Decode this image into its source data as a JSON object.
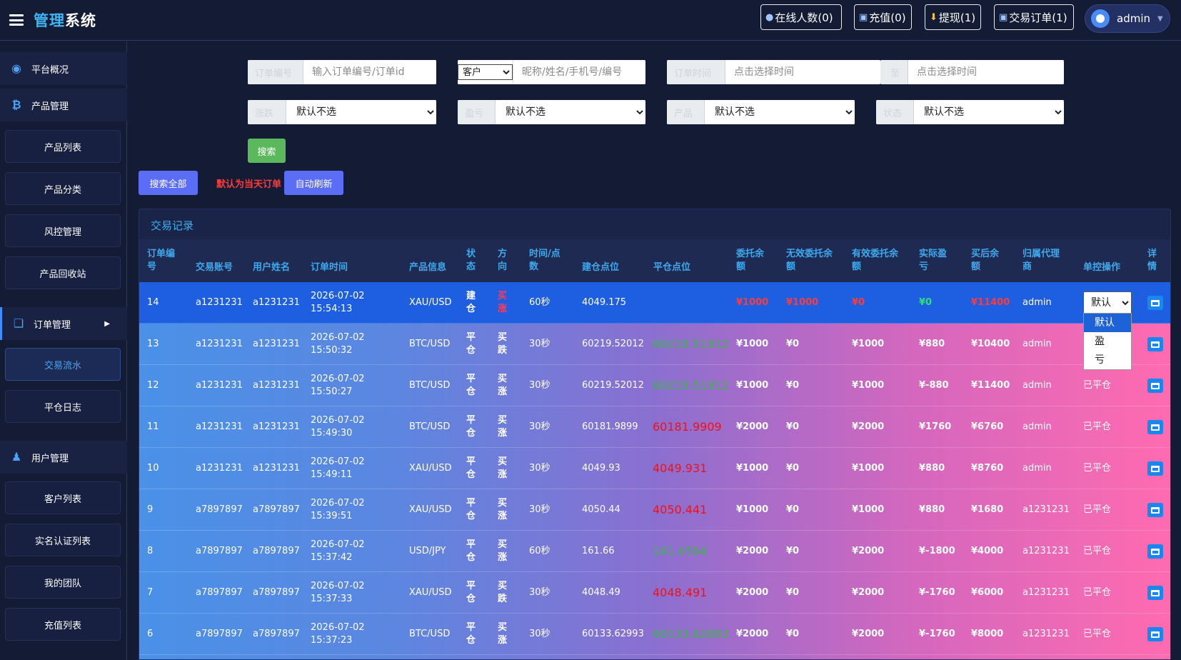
{
  "header": {
    "logo_part1": "管理",
    "logo_part2": "系统",
    "online": "在线人数(0)",
    "recharge": "充值(0)",
    "withdraw": "提现(1)",
    "orders": "交易订单(1)",
    "admin": "admin"
  },
  "sidebar": {
    "groups": [
      "平台概况",
      "产品管理",
      "订单管理",
      "用户管理"
    ],
    "items": [
      "产品列表",
      "产品分类",
      "风控管理",
      "产品回收站",
      "交易流水",
      "平仓日志",
      "客户列表",
      "实名认证列表",
      "我的团队",
      "充值列表"
    ]
  },
  "filters": {
    "order_no_label": "订单编号",
    "order_no_placeholder": "输入订单编号/订单id",
    "customer_option": "客户",
    "customer_placeholder": "昵称/姓名/手机号/编号",
    "time_label": "订单时间",
    "time_placeholder": "点击选择时间",
    "to_label": "至",
    "time_placeholder2": "点击选择时间",
    "updown_label": "涨跌",
    "profit_label": "盈亏",
    "product_label": "产品",
    "status_label": "状态",
    "default_option": "默认不选",
    "search_btn": "搜索",
    "search_all_btn": "搜索全部",
    "note": "默认为当天订单",
    "auto_refresh_btn": "自动刷新"
  },
  "panel": {
    "title": "交易记录",
    "headers": [
      "订单编号",
      "交易账号",
      "用户姓名",
      "订单时间",
      "产品信息",
      "状态",
      "方向",
      "时间/点数",
      "建仓点位",
      "平仓点位",
      "委托余额",
      "无效委托余额",
      "有效委托余额",
      "实际盈亏",
      "买后余额",
      "归属代理商",
      "单控操作",
      "详情"
    ]
  },
  "rows": [
    {
      "id": "14",
      "account": "a1231231",
      "name": "a1231231",
      "date": "2026-07-02",
      "time": "15:54:13",
      "product": "XAU/USD",
      "status": "建仓",
      "dir": "买涨",
      "period": "60秒",
      "open": "4049.175",
      "close": "",
      "close_color": "",
      "amount": "¥1000",
      "invalid": "¥1000",
      "valid": "¥0",
      "pnl": "¥0",
      "after": "¥11400",
      "agent": "admin",
      "op": ""
    },
    {
      "id": "13",
      "account": "a1231231",
      "name": "a1231231",
      "date": "2026-07-02",
      "time": "15:50:32",
      "product": "BTC/USD",
      "status": "平仓",
      "dir": "买跌",
      "period": "30秒",
      "open": "60219.52012",
      "close": "60219.51912",
      "close_color": "#3bb54a",
      "amount": "¥1000",
      "invalid": "¥0",
      "valid": "¥1000",
      "pnl": "¥880",
      "after": "¥10400",
      "agent": "admin",
      "op": ""
    },
    {
      "id": "12",
      "account": "a1231231",
      "name": "a1231231",
      "date": "2026-07-02",
      "time": "15:50:27",
      "product": "BTC/USD",
      "status": "平仓",
      "dir": "买涨",
      "period": "30秒",
      "open": "60219.52012",
      "close": "60219.51912",
      "close_color": "#3bb54a",
      "amount": "¥1000",
      "invalid": "¥0",
      "valid": "¥1000",
      "pnl": "¥-880",
      "after": "¥11400",
      "agent": "admin",
      "op": "已平仓"
    },
    {
      "id": "11",
      "account": "a1231231",
      "name": "a1231231",
      "date": "2026-07-02",
      "time": "15:49:30",
      "product": "BTC/USD",
      "status": "平仓",
      "dir": "买涨",
      "period": "30秒",
      "open": "60181.9899",
      "close": "60181.9909",
      "close_color": "#e8141c",
      "amount": "¥2000",
      "invalid": "¥0",
      "valid": "¥2000",
      "pnl": "¥1760",
      "after": "¥6760",
      "agent": "admin",
      "op": "已平仓"
    },
    {
      "id": "10",
      "account": "a1231231",
      "name": "a1231231",
      "date": "2026-07-02",
      "time": "15:49:11",
      "product": "XAU/USD",
      "status": "平仓",
      "dir": "买涨",
      "period": "30秒",
      "open": "4049.93",
      "close": "4049.931",
      "close_color": "#e8141c",
      "amount": "¥1000",
      "invalid": "¥0",
      "valid": "¥1000",
      "pnl": "¥880",
      "after": "¥8760",
      "agent": "admin",
      "op": "已平仓"
    },
    {
      "id": "9",
      "account": "a7897897",
      "name": "a7897897",
      "date": "2026-07-02",
      "time": "15:39:51",
      "product": "XAU/USD",
      "status": "平仓",
      "dir": "买涨",
      "period": "30秒",
      "open": "4050.44",
      "close": "4050.441",
      "close_color": "#e8141c",
      "amount": "¥1000",
      "invalid": "¥0",
      "valid": "¥1000",
      "pnl": "¥880",
      "after": "¥1680",
      "agent": "a1231231",
      "op": "已平仓"
    },
    {
      "id": "8",
      "account": "a7897897",
      "name": "a7897897",
      "date": "2026-07-02",
      "time": "15:37:42",
      "product": "USD/JPY",
      "status": "平仓",
      "dir": "买涨",
      "period": "60秒",
      "open": "161.66",
      "close": "161.6564",
      "close_color": "#3bb54a",
      "amount": "¥2000",
      "invalid": "¥0",
      "valid": "¥2000",
      "pnl": "¥-1800",
      "after": "¥4000",
      "agent": "a1231231",
      "op": "已平仓"
    },
    {
      "id": "7",
      "account": "a7897897",
      "name": "a7897897",
      "date": "2026-07-02",
      "time": "15:37:33",
      "product": "XAU/USD",
      "status": "平仓",
      "dir": "买跌",
      "period": "30秒",
      "open": "4048.49",
      "close": "4048.491",
      "close_color": "#e8141c",
      "amount": "¥2000",
      "invalid": "¥0",
      "valid": "¥2000",
      "pnl": "¥-1760",
      "after": "¥6000",
      "agent": "a1231231",
      "op": "已平仓"
    },
    {
      "id": "6",
      "account": "a7897897",
      "name": "a7897897",
      "date": "2026-07-02",
      "time": "15:37:23",
      "product": "BTC/USD",
      "status": "平仓",
      "dir": "买涨",
      "period": "30秒",
      "open": "60133.62993",
      "close": "60133.62893",
      "close_color": "#3bb54a",
      "amount": "¥2000",
      "invalid": "¥0",
      "valid": "¥2000",
      "pnl": "¥-1760",
      "after": "¥8000",
      "agent": "a1231231",
      "op": "已平仓"
    }
  ],
  "op_control": {
    "selected": "默认",
    "options": [
      "默认",
      "盈",
      "亏"
    ]
  },
  "colors": {
    "accent": "#3fb5f5",
    "green_btn": "#5cb85c",
    "blue_btn": "#5b6cf5",
    "red": "#ff3b3b"
  }
}
